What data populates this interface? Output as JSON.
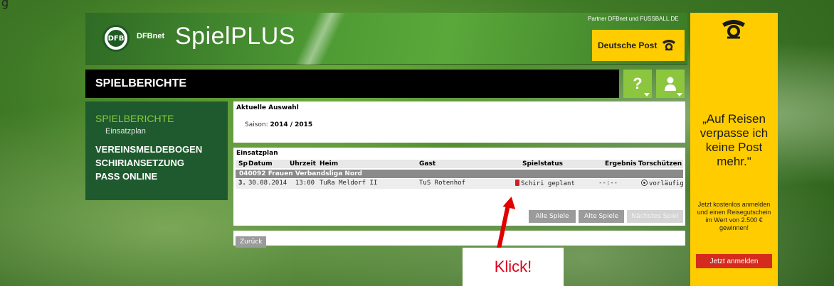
{
  "top_fragment": "g",
  "header": {
    "logo_inner": "DFB",
    "dfbnet_label": "DFBnet",
    "app_title": "SpielPLUS",
    "partner_text": "Partner DFBnet und FUSSBALL.DE",
    "sponsor_name": "Deutsche Post"
  },
  "titlebar": {
    "title": "SPIELBERICHTE",
    "help_label": "?"
  },
  "sidebar": {
    "active_item": "SPIELBERICHTE",
    "active_sub": "Einsatzplan",
    "items": [
      {
        "label": "VEREINSMELDEBOGEN"
      },
      {
        "label": "SCHIRIANSETZUNG"
      },
      {
        "label": "PASS ONLINE"
      }
    ]
  },
  "selection": {
    "heading": "Aktuelle Auswahl",
    "saison_label": "Saison:",
    "saison_value": "2014 / 2015"
  },
  "einsatzplan": {
    "heading": "Einsatzplan",
    "columns": {
      "sp": "Sp",
      "datum": "Datum",
      "uhrzeit": "Uhrzeit",
      "heim": "Heim",
      "gast": "Gast",
      "spielstatus": "Spielstatus",
      "ergebnis": "Ergebnis",
      "torschuetzen": "Torschützen"
    },
    "league": "040092 Frauen Verbandsliga Nord",
    "rows": [
      {
        "sp": "3.",
        "datum": "30.08.2014",
        "uhrzeit": "13:00",
        "heim": "TuRa Meldorf II",
        "gast": "TuS Rotenhof",
        "spielstatus": "Schiri geplant",
        "ergebnis": "--:--",
        "torschuetzen": "vorläufig"
      }
    ],
    "buttons": {
      "alle": "Alle Spiele",
      "alte": "Alte Spiele",
      "naechstes": "Nächstes Spiel"
    }
  },
  "footer": {
    "back_label": "Zurück"
  },
  "annotation": {
    "label": "Klick!"
  },
  "ad": {
    "slogan": "„Auf Reisen verpasse ich keine Post mehr.\"",
    "promo": "Jetzt kostenlos anmelden und einen Reisegutschein im Wert von 2.500 € gewinnen!",
    "cta": "Jetzt anmelden"
  },
  "colors": {
    "accent_green": "#8cc63f",
    "menu_green": "#1e5a2d",
    "post_yellow": "#ffcc00",
    "annotation_red": "#e00000"
  }
}
